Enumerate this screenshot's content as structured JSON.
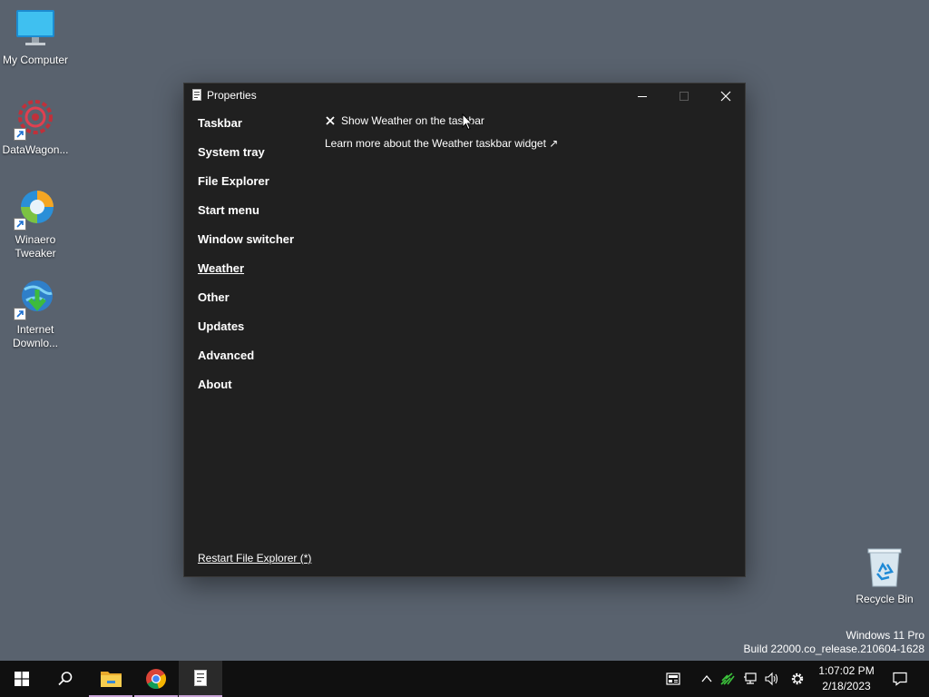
{
  "desktop": {
    "icons": [
      {
        "label": "My Computer",
        "icon": "computer-icon"
      },
      {
        "label": "DataWagon...",
        "icon": "datawagon-icon"
      },
      {
        "label": "Winaero Tweaker",
        "icon": "winaero-icon"
      },
      {
        "label": "Internet Downlo...",
        "icon": "internet-download-icon"
      }
    ],
    "recycle_bin": {
      "label": "Recycle Bin",
      "icon": "recycle-bin-icon"
    }
  },
  "window": {
    "title": "Properties",
    "title_icon": "document-icon",
    "controls": {
      "minimize": "minimize-icon",
      "maximize": "maximize-icon",
      "close": "close-icon"
    },
    "nav": [
      {
        "label": "Taskbar",
        "active": false
      },
      {
        "label": "System tray",
        "active": false
      },
      {
        "label": "File Explorer",
        "active": false
      },
      {
        "label": "Start menu",
        "active": false
      },
      {
        "label": "Window switcher",
        "active": false
      },
      {
        "label": "Weather",
        "active": true
      },
      {
        "label": "Other",
        "active": false
      },
      {
        "label": "Updates",
        "active": false
      },
      {
        "label": "Advanced",
        "active": false
      },
      {
        "label": "About",
        "active": false
      }
    ],
    "content": {
      "option": {
        "label": "Show Weather on the taskbar",
        "state_icon": "x-icon"
      },
      "link": "Learn more about the Weather taskbar widget ↗"
    },
    "footer_link": "Restart File Explorer (*)"
  },
  "watermark": {
    "line1": "Windows 11 Pro",
    "line2": "Build 22000.co_release.210604-1628"
  },
  "taskbar": {
    "apps": [
      {
        "name": "start",
        "icon": "windows-logo-icon"
      },
      {
        "name": "search",
        "icon": "search-icon"
      },
      {
        "name": "file-explorer",
        "icon": "folder-icon"
      },
      {
        "name": "chrome",
        "icon": "chrome-icon"
      },
      {
        "name": "properties",
        "icon": "document-icon"
      }
    ],
    "tray": [
      "news-icon",
      "chevron-up-icon",
      "network-activity-icon",
      "network-icon",
      "volume-icon",
      "settings-gear-icon"
    ],
    "clock": {
      "time": "1:07:02 PM",
      "date": "2/18/2023"
    },
    "notifications_icon": "notification-icon"
  },
  "colors": {
    "desktop_bg": "#59626e",
    "window_bg": "#202020",
    "taskbar_bg": "#101010",
    "active_app_indicator": "#c9a4d8"
  }
}
